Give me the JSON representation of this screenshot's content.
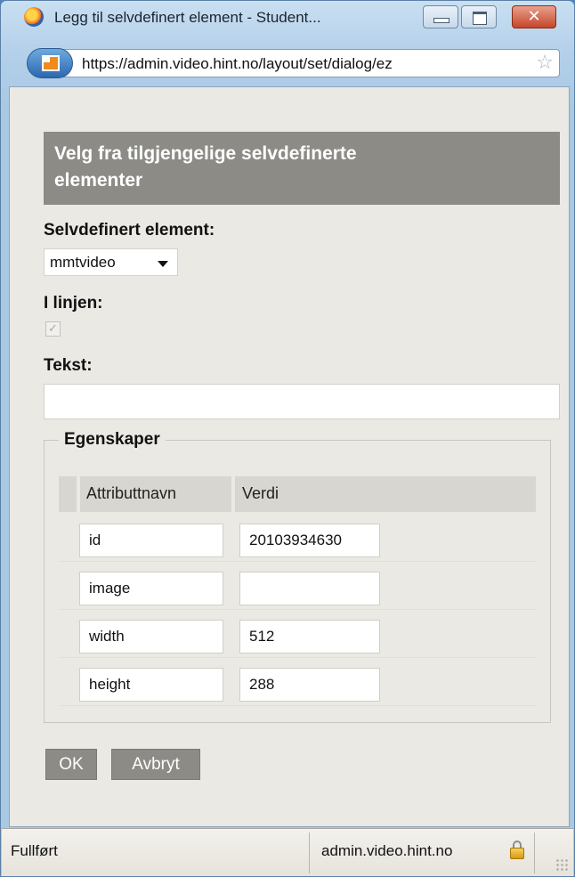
{
  "window": {
    "title": "Legg til selvdefinert element - Student...",
    "url": "https://admin.video.hint.no/layout/set/dialog/ez"
  },
  "dialog": {
    "heading_line1": "Velg fra tilgjengelige selvdefinerte",
    "heading_line2": "elementer",
    "element_label": "Selvdefinert element:",
    "element_value": "mmtvideo",
    "inline_label": "I linjen:",
    "inline_checked": true,
    "text_label": "Tekst:",
    "text_value": "",
    "properties_legend": "Egenskaper",
    "columns": [
      "Attributtnavn",
      "Verdi"
    ],
    "rows": [
      {
        "name": "id",
        "value": "20103934630"
      },
      {
        "name": "image",
        "value": ""
      },
      {
        "name": "width",
        "value": "512"
      },
      {
        "name": "height",
        "value": "288"
      }
    ],
    "ok_label": "OK",
    "cancel_label": "Avbryt"
  },
  "status": {
    "left": "Fullført",
    "right": "admin.video.hint.no"
  },
  "colors": {
    "heading_bg": "#8c8b86",
    "content_bg": "#ebe9e4",
    "button_bg": "#8c8b86"
  },
  "icons": [
    "firefox-icon",
    "minimize-icon",
    "maximize-icon",
    "close-icon",
    "site-identity-icon",
    "bookmark-star-icon",
    "checkmark-icon",
    "dropdown-arrow-icon",
    "lock-icon",
    "resize-grip-icon"
  ]
}
